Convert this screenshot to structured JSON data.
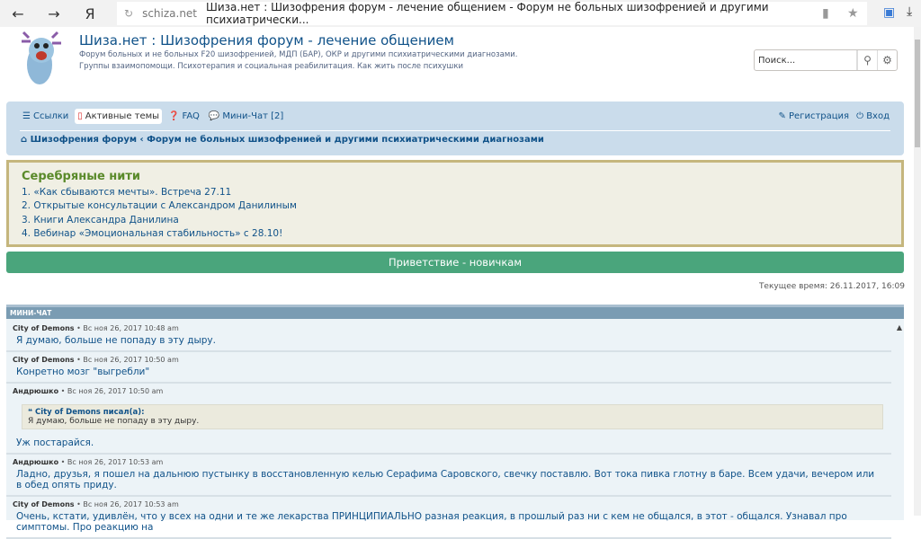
{
  "browser": {
    "back": "←",
    "forward": "→",
    "yandex": "Я",
    "reload": "↻",
    "domain": "schiza.net",
    "title": "Шиза.нет : Шизофрения форум - лечение общением - Форум не больных шизофренией и другими психиатрически..."
  },
  "header": {
    "title": "Шиза.нет : Шизофрения форум - лечение общением",
    "description": "Форум больных и не больных F20 шизофренией, МДП (БАР), ОКР и другими психиатрическими диагнозами. Группы взаимопомощи. Психотерапия и социальная реабилитация. Как жить после психушки",
    "search_placeholder": "Поиск..."
  },
  "nav": {
    "links": "Ссылки",
    "active": "Активные темы",
    "faq": "FAQ",
    "chat": "Мини-Чат [2]",
    "register": "Регистрация",
    "login": "Вход",
    "breadcrumb": [
      "Шизофрения форум",
      "Форум не больных шизофренией и другими психиатрическими диагнозами"
    ]
  },
  "announce": {
    "title": "Серебряные нити",
    "items": [
      "1. «Как сбываются мечты». Встреча 27.11",
      "2. Открытые консультации с Александром Данилиным",
      "3. Книги Александра Данилина",
      "4. Вебинар «Эмоциональная стабильность» с 28.10!"
    ]
  },
  "welcome": "Приветствие - новичкам",
  "time": "Текущее время: 26.11.2017, 16:09",
  "chat": {
    "title": "МИНИ-ЧАТ",
    "posts": [
      {
        "author": "City of Demons",
        "date": "Вс ноя 26, 2017 10:48 am",
        "text": "Я думаю, больше не попаду в эту дыру."
      },
      {
        "author": "City of Demons",
        "date": "Вс ноя 26, 2017 10:50 am",
        "text": "Конретно мозг \"выгребли\""
      },
      {
        "author": "Андрюшко",
        "date": "Вс ноя 26, 2017 10:50 am",
        "quote_author": "City of Demons писал(а):",
        "quote_text": "Я думаю, больше не попаду в эту дыру.",
        "text": "Уж постарайся."
      },
      {
        "author": "Андрюшко",
        "date": "Вс ноя 26, 2017 10:53 am",
        "text": "Ладно, друзья, я пошел на дальнюю пустынку в восстановленную келью Серафима Саровского, свечку поставлю. Вот тока пивка глотну в баре. Всем удачи, вечером или в обед опять приду."
      },
      {
        "author": "City of Demons",
        "date": "Вс ноя 26, 2017 10:53 am",
        "text": "Очень, кстати, удивлён, что у всех на одни и те же лекарства ПРИНЦИПИАЛЬНО разная реакция, в прошлый раз ни с кем не общался, в этот - общался. Узнавал про симптомы. Про реакцию на"
      }
    ]
  }
}
